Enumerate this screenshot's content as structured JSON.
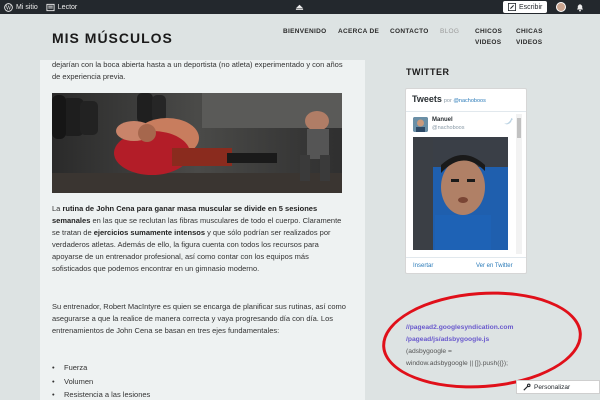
{
  "admin_bar": {
    "site_label": "Mi sitio",
    "reader_label": "Lector",
    "write_label": "Escribir"
  },
  "header": {
    "site_title": "MIS MÚSCULOS",
    "nav": [
      {
        "label": "BIENVENIDO"
      },
      {
        "label": "ACERCA DE"
      },
      {
        "label": "CONTACTO"
      },
      {
        "label": "BLOG"
      },
      {
        "line1": "CHICOS",
        "line2": "VIDEOS"
      },
      {
        "line1": "CHICAS",
        "line2": "VIDEOS"
      }
    ]
  },
  "article": {
    "para_top": "dejarían con la boca abierta hasta a un deportista (no atleta) experimentado y con años de experiencia previa.",
    "p1": {
      "t1": "La ",
      "b1": "rutina de John Cena para ganar masa muscular se divide en 5 sesiones semanales",
      "t2": " en las que se reclutan las fibras musculares de todo el cuerpo. Claramente se tratan de ",
      "b2": "ejercicios sumamente intensos",
      "t3": " y que sólo podrían ser realizados por verdaderos atletas. Además de ello, la figura cuenta con todos los recursos para apoyarse de un entrenador profesional, así como contar con los equipos más sofisticados que podemos encontrar en un gimnasio moderno."
    },
    "p2": "Su entrenador, Robert MacIntyre es quien se encarga de planificar sus rutinas, así como asegurarse a que la realice de manera correcta y vaya progresando día con día. Los entrenamientos de John Cena se basan en tres ejes fundamentales:",
    "list": [
      "Fuerza",
      "Volumen",
      "Resistencia a las lesiones"
    ]
  },
  "sidebar": {
    "twitter_title": "TWITTER",
    "tweets_heading": "Tweets",
    "tweets_by": "por",
    "tweets_by_handle": "@nachoboos",
    "user_name": "Manuel",
    "user_handle": "@nachoboos",
    "embed_label": "Insertar",
    "view_label": "Ver en Twitter",
    "ad_link1": "//pagead2.googlesyndication.com",
    "ad_link2": "/pagead/js/adsbygoogle.js",
    "ad_code1": "(adsbygoogle =",
    "ad_code2": "window.adsbygoogle || []).push({});"
  },
  "customize_label": "Personalizar",
  "colors": {
    "admin_bar": "#23282d",
    "page_bg": "#dde3e3",
    "content_bg": "#eef2f2",
    "highlight_circle": "#e0101a",
    "ad_link": "#6a5acd"
  }
}
